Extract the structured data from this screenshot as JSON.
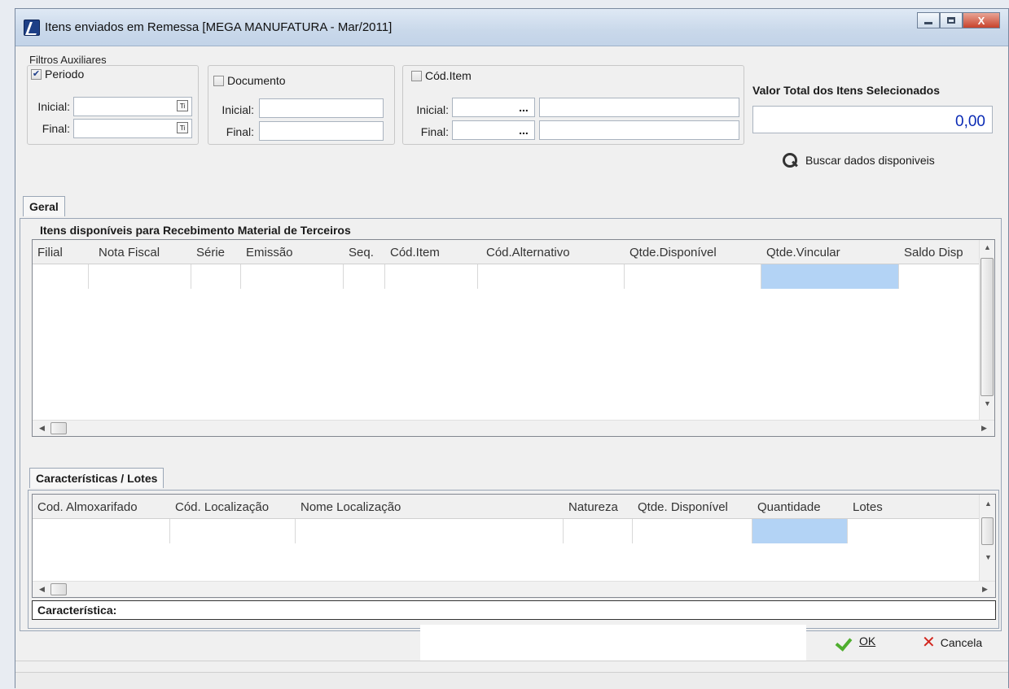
{
  "window": {
    "title": "Itens enviados em Remessa [MEGA MANUFATURA - Mar/2011]",
    "close_symbol": "X"
  },
  "filters": {
    "group_label": "Filtros Auxiliares",
    "periodo": {
      "label": "Periodo",
      "checked": true,
      "inicial_label": "Inicial:",
      "final_label": "Final:",
      "inicial_value": "",
      "final_value": ""
    },
    "documento": {
      "label": "Documento",
      "checked": false,
      "inicial_label": "Inicial:",
      "final_label": "Final:",
      "inicial_value": "",
      "final_value": ""
    },
    "cod_item": {
      "label": "Cód.Item",
      "checked": false,
      "inicial_label": "Inicial:",
      "final_label": "Final:",
      "ellipsis": "..."
    }
  },
  "total": {
    "label": "Valor Total dos Itens Selecionados",
    "value": "0,00"
  },
  "buscar_label": "Buscar dados disponiveis",
  "tabs": {
    "geral": "Geral",
    "caracteristicas": "Características / Lotes"
  },
  "items_grid": {
    "title": "Itens disponíveis para Recebimento Material de Terceiros",
    "columns": [
      "Filial",
      "Nota Fiscal",
      "Série",
      "Emissão",
      "Seq.",
      "Cód.Item",
      "Cód.Alternativo",
      "Qtde.Disponível",
      "Qtde.Vincular",
      "Saldo Disp"
    ]
  },
  "lotes_grid": {
    "columns": [
      "Cod. Almoxarifado",
      "Cód. Localização",
      "Nome Localização",
      "Natureza",
      "Qtde. Disponível",
      "Quantidade",
      "Lotes"
    ]
  },
  "caracteristica_label": "Característica:",
  "footer": {
    "ok_label": "OK",
    "cancel_label": "Cancela"
  },
  "colors": {
    "selected_cell": "#b3d3f5",
    "total_value": "#0b2bb5"
  },
  "icons": [
    "app-icon",
    "calendar-icon",
    "ellipsis-icon",
    "search-icon",
    "check-icon",
    "cancel-icon"
  ]
}
